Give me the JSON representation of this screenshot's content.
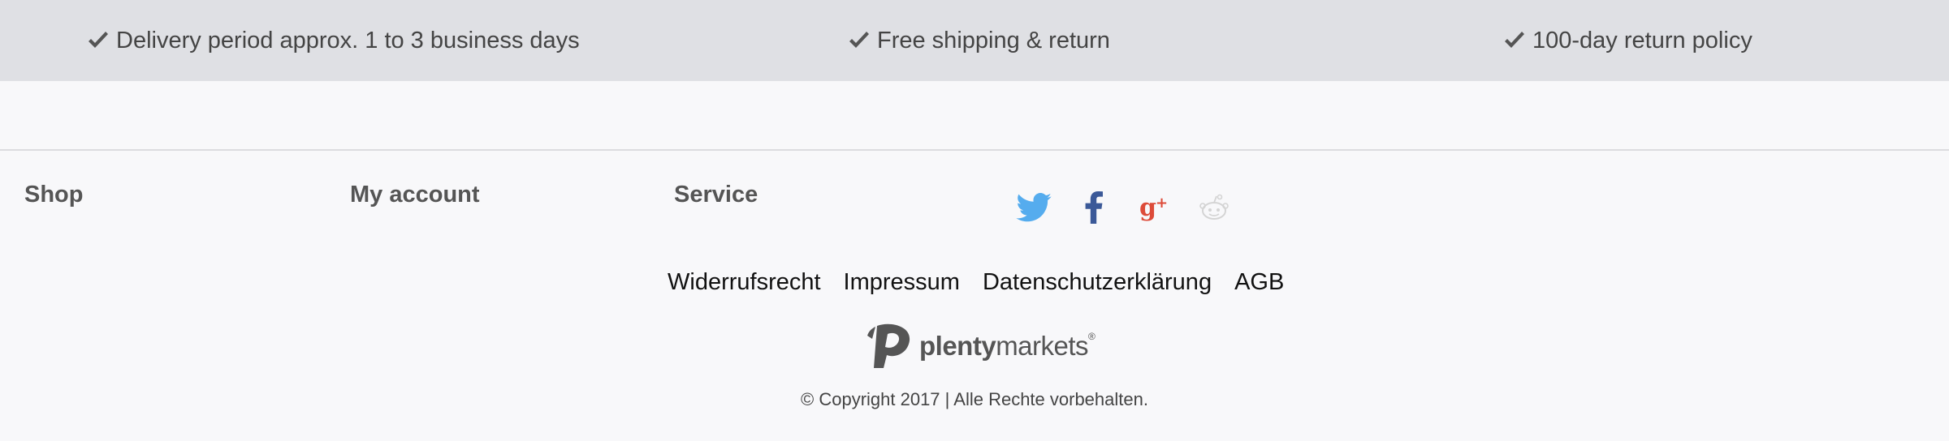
{
  "usp": [
    {
      "icon": "check-icon",
      "text": "Delivery period approx. 1 to 3 business days"
    },
    {
      "icon": "check-icon",
      "text": "Free shipping & return"
    },
    {
      "icon": "check-icon",
      "text": "100-day return policy"
    }
  ],
  "footer": {
    "columns": [
      {
        "heading": "Shop"
      },
      {
        "heading": "My account"
      },
      {
        "heading": "Service"
      }
    ],
    "social": [
      {
        "icon": "twitter-icon",
        "color": "#55acee"
      },
      {
        "icon": "facebook-icon",
        "color": "#3b5998"
      },
      {
        "icon": "google-plus-icon",
        "color": "#dd4b39"
      },
      {
        "icon": "reddit-icon",
        "color": "#d8d8d8"
      }
    ],
    "legal_links": [
      "Widerrufsrecht",
      "Impressum",
      "Datenschutzerklärung",
      "AGB"
    ],
    "brand": {
      "bold": "plenty",
      "regular": "markets",
      "registered": "®"
    },
    "copyright": "© Copyright 2017 | Alle Rechte vorbehalten."
  },
  "colors": {
    "usp_background": "#dfe0e4",
    "page_background": "#f8f8fa",
    "text": "#444444",
    "heading": "#555555"
  }
}
